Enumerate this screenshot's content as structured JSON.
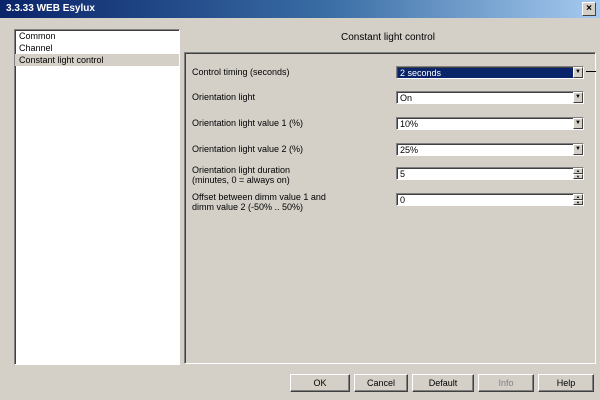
{
  "window": {
    "title": "3.3.33 WEB Esylux",
    "close_glyph": "×"
  },
  "nav": {
    "items": [
      {
        "label": "Common"
      },
      {
        "label": "Channel"
      },
      {
        "label": "Constant light control"
      }
    ]
  },
  "content": {
    "header": "Constant light control",
    "rows": [
      {
        "label": "Control timing (seconds)",
        "value": "2 seconds",
        "control": "dropdown",
        "selected": true
      },
      {
        "label": "Orientation light",
        "value": "On",
        "control": "dropdown"
      },
      {
        "label": "Orientation light value 1 (%)",
        "value": "10%",
        "control": "dropdown"
      },
      {
        "label": "Orientation light value 2 (%)",
        "value": "25%",
        "control": "dropdown"
      },
      {
        "label": "Orientation light duration\n(minutes, 0 = always on)",
        "value": "5",
        "control": "spinner"
      },
      {
        "label": "Offset between dimm value 1 and\ndimm value 2 (-50% .. 50%)",
        "value": "0",
        "control": "spinner"
      }
    ]
  },
  "buttons": {
    "ok": "OK",
    "cancel": "Cancel",
    "default": "Default",
    "info": "Info",
    "help": "Help"
  },
  "colors": {
    "selection": "#0a246a",
    "face": "#d4d0c8"
  }
}
